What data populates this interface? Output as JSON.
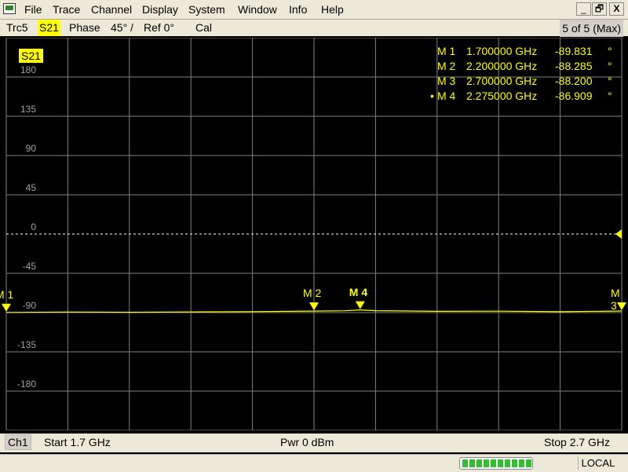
{
  "menubar": {
    "items": [
      "File",
      "Trace",
      "Channel",
      "Display",
      "System",
      "Window",
      "Info",
      "Help"
    ],
    "minimize_label": "_",
    "restore_label": "🗗",
    "close_label": "X"
  },
  "trace_info": {
    "trace": "Trc5",
    "parameter": "S21",
    "format": "Phase",
    "scale": "45° /",
    "ref": "Ref 0°",
    "cal": "Cal",
    "count": "5 of 5 (Max)"
  },
  "diagram": {
    "trace_label": "S21",
    "trace_color": "#ffff00",
    "grid_color": "#808080",
    "reference_value": 0,
    "markers": [
      {
        "name": "M 1",
        "freq": "1.700000 GHz",
        "value": "-89.831",
        "unit": "°",
        "active": false
      },
      {
        "name": "M 2",
        "freq": "2.200000 GHz",
        "value": "-88.285",
        "unit": "°",
        "active": false
      },
      {
        "name": "M 3",
        "freq": "2.700000 GHz",
        "value": "-88.200",
        "unit": "°",
        "active": false
      },
      {
        "name": "M 4",
        "freq": "2.275000 GHz",
        "value": "-86.909",
        "unit": "°",
        "active": true
      }
    ],
    "active_marker_dot": "•"
  },
  "chart_data": {
    "type": "line",
    "x_unit": "GHz",
    "y_unit": "°",
    "xlim": [
      1.7,
      2.7
    ],
    "ylim": [
      -225,
      225
    ],
    "yticks": [
      180,
      135,
      90,
      45,
      0,
      -45,
      -90,
      -135,
      -180
    ],
    "ytick_labels": [
      "180",
      "135",
      "90",
      "45",
      "0",
      "-45",
      "-90",
      "-135",
      "-180"
    ],
    "grid": true,
    "series": [
      {
        "x": [
          1.7,
          1.8,
          1.9,
          2.0,
          2.1,
          2.2,
          2.25,
          2.275,
          2.3,
          2.4,
          2.5,
          2.6,
          2.7
        ],
        "y": [
          -89.8,
          -89.4,
          -89.6,
          -89.3,
          -88.9,
          -88.3,
          -87.9,
          -86.9,
          -87.8,
          -88.6,
          -88.4,
          -89.0,
          -88.2
        ]
      }
    ]
  },
  "status": {
    "channel": "Ch1",
    "start": "Start  1.7 GHz",
    "power": "Pwr  0 dBm",
    "stop": "Stop  2.7 GHz"
  },
  "bottombar": {
    "progress_fraction": 1.0,
    "mode": "LOCAL"
  }
}
